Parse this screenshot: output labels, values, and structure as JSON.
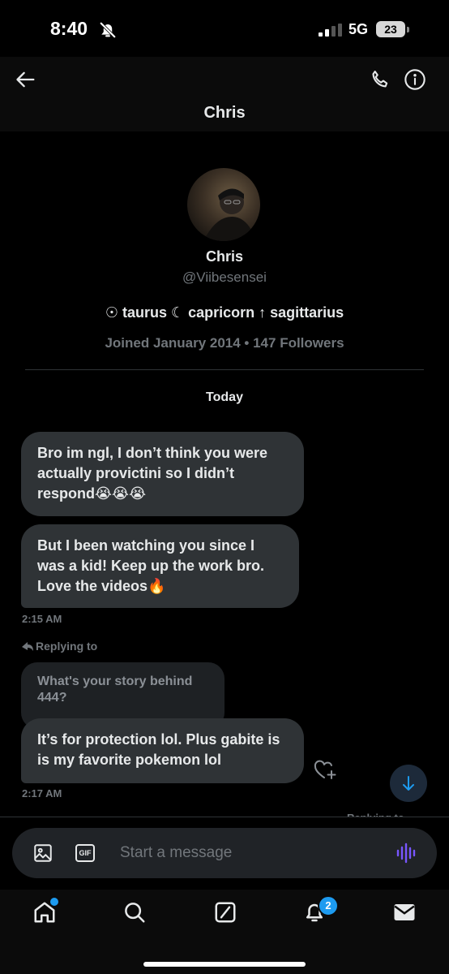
{
  "status_bar": {
    "time": "8:40",
    "network": "5G",
    "battery": "23"
  },
  "header": {
    "title": "Chris"
  },
  "profile": {
    "name": "Chris",
    "handle": "@Viibesensei",
    "bio": "☉ taurus ☾ capricorn ↑ sagittarius",
    "meta": "Joined January 2014 • 147 Followers"
  },
  "conversation": {
    "day_label": "Today",
    "messages": [
      {
        "text": "Bro im ngl, I don’t think you were actually provictini so I didn’t respond😭😭😭"
      },
      {
        "text": "But I been watching you since I was a kid! Keep up the work bro. Love the videos🔥",
        "time": "2:15 AM"
      },
      {
        "replying_label": "Replying to",
        "quoted": "What's your story behind 444?",
        "text": "It’s for protection lol. Plus gabite is is my favorite pokemon lol",
        "time": "2:17 AM"
      }
    ],
    "peek_text": "Replying to"
  },
  "composer": {
    "placeholder": "Start a message",
    "gif_label": "GIF"
  },
  "tabbar": {
    "notification_count": "2"
  },
  "colors": {
    "accent": "#1d9bf0",
    "bubble": "#2f3336",
    "muted": "#71767b",
    "voice": "#7856ff"
  }
}
